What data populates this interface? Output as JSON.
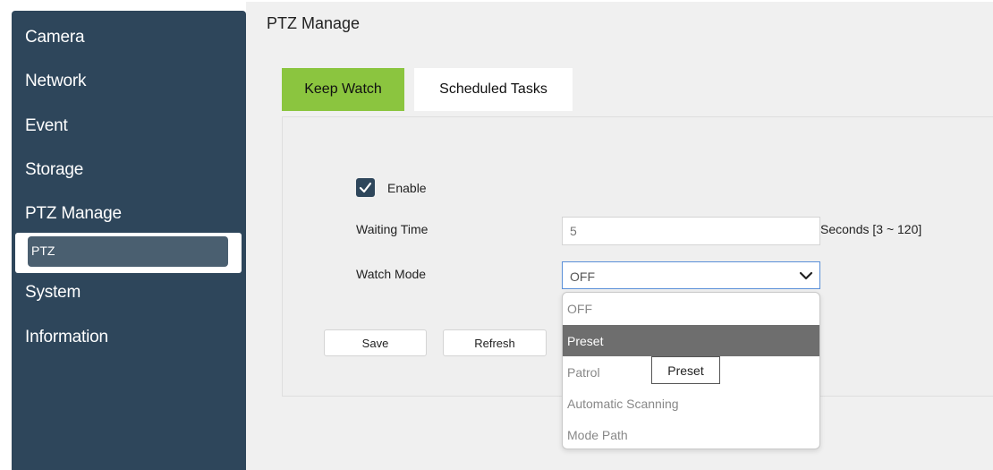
{
  "sidebar": {
    "items": [
      {
        "label": "Camera"
      },
      {
        "label": "Network"
      },
      {
        "label": "Event"
      },
      {
        "label": "Storage"
      },
      {
        "label": "PTZ Manage"
      },
      {
        "label": "System"
      },
      {
        "label": "Information"
      }
    ],
    "sub_item": {
      "label": "PTZ"
    }
  },
  "page": {
    "title": "PTZ Manage"
  },
  "tabs": [
    {
      "label": "Keep Watch",
      "active": true
    },
    {
      "label": "Scheduled Tasks",
      "active": false
    }
  ],
  "form": {
    "enable": {
      "label": "Enable",
      "checked": true
    },
    "waiting_time": {
      "label": "Waiting Time",
      "value": "5",
      "hint": "Seconds [3 ~ 120]"
    },
    "watch_mode": {
      "label": "Watch Mode",
      "value": "OFF",
      "options": [
        "OFF",
        "Preset",
        "Patrol",
        "Automatic Scanning",
        "Mode Path"
      ],
      "highlighted": "Preset",
      "tooltip": "Preset"
    }
  },
  "buttons": {
    "save": "Save",
    "refresh": "Refresh"
  },
  "colors": {
    "sidebar_bg": "#2e465b",
    "tab_active": "#8bc53f",
    "highlight": "#6e6e6e",
    "select_border": "#5a8fd8"
  },
  "icons": {
    "checkbox": "check-icon",
    "select": "chevron-down-icon"
  }
}
